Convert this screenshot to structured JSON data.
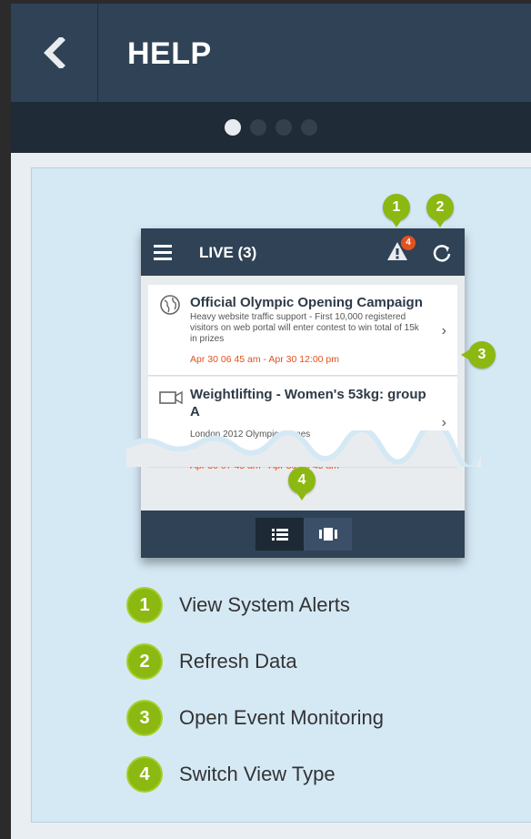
{
  "header": {
    "title": "HELP",
    "back_icon": "chevron-left-icon"
  },
  "pager": {
    "count": 4,
    "active_index": 0
  },
  "mockup": {
    "bar_title": "LIVE (3)",
    "alert_badge": "4",
    "cards": [
      {
        "title": "Official Olympic Opening Campaign",
        "description": "Heavy website traffic support - First 10,000 registered visitors on web portal will enter contest to win total of 15k in prizes",
        "time": "Apr 30 06 45 am - Apr 30 12:00 pm",
        "icon": "globe-icon"
      },
      {
        "title": "Weightlifting - Women's 53kg: group A",
        "description": "London 2012 Olympic Games",
        "time": "Apr 30 07 45 am - Apr 30 10 45 am",
        "icon": "video-camera-icon"
      }
    ],
    "pins": [
      "1",
      "2",
      "3",
      "4"
    ]
  },
  "legend": [
    {
      "num": "1",
      "label": "View System Alerts"
    },
    {
      "num": "2",
      "label": "Refresh Data"
    },
    {
      "num": "3",
      "label": "Open Event Monitoring"
    },
    {
      "num": "4",
      "label": "Switch View Type"
    }
  ],
  "colors": {
    "accent": "#8cb812",
    "header": "#2f4256",
    "alert": "#e2521e",
    "panel": "#d5e9f5"
  }
}
